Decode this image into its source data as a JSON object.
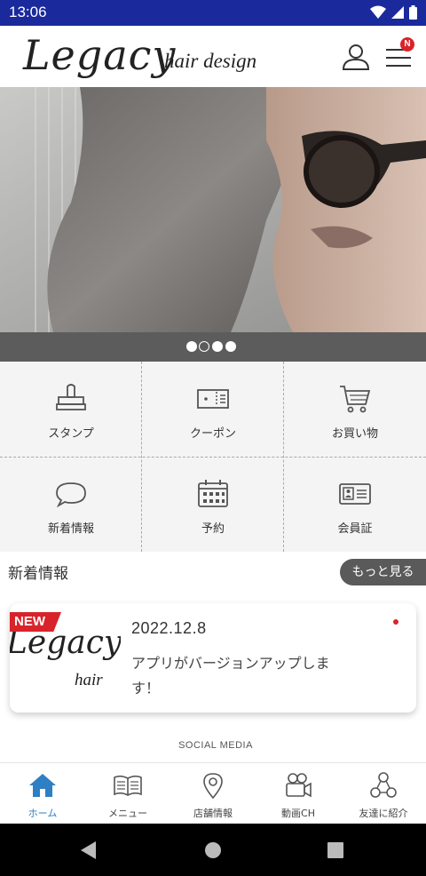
{
  "status_bar": {
    "time": "13:06"
  },
  "header": {
    "logo": "Legacy",
    "logo_sub": "hair design",
    "menu_badge": "N"
  },
  "carousel": {
    "pages": 4,
    "active_index": 1
  },
  "grid": [
    {
      "label": "スタンプ",
      "icon": "stamp-icon"
    },
    {
      "label": "クーポン",
      "icon": "coupon-icon"
    },
    {
      "label": "お買い物",
      "icon": "cart-icon"
    },
    {
      "label": "新着情報",
      "icon": "speech-bubble-icon"
    },
    {
      "label": "予約",
      "icon": "calendar-icon"
    },
    {
      "label": "会員証",
      "icon": "member-card-icon"
    }
  ],
  "news": {
    "title": "新着情報",
    "more_label": "もっと見る",
    "items": [
      {
        "badge": "NEW",
        "thumb_logo": "Legacy",
        "thumb_sub": "hair",
        "date": "2022.12.8",
        "text": "アプリがバージョンアップします！"
      }
    ]
  },
  "social_label": "SOCIAL MEDIA",
  "bottom_nav": [
    {
      "label": "ホーム",
      "icon": "home-icon"
    },
    {
      "label": "メニュー",
      "icon": "book-icon"
    },
    {
      "label": "店舗情報",
      "icon": "map-pin-icon"
    },
    {
      "label": "動画CH",
      "icon": "video-camera-icon"
    },
    {
      "label": "友達に紹介",
      "icon": "share-network-icon"
    }
  ],
  "colors": {
    "status_bar": "#1a2a9c",
    "accent_red": "#d9232a",
    "active_nav": "#2e7fc4",
    "grid_bg": "#f4f4f4"
  }
}
